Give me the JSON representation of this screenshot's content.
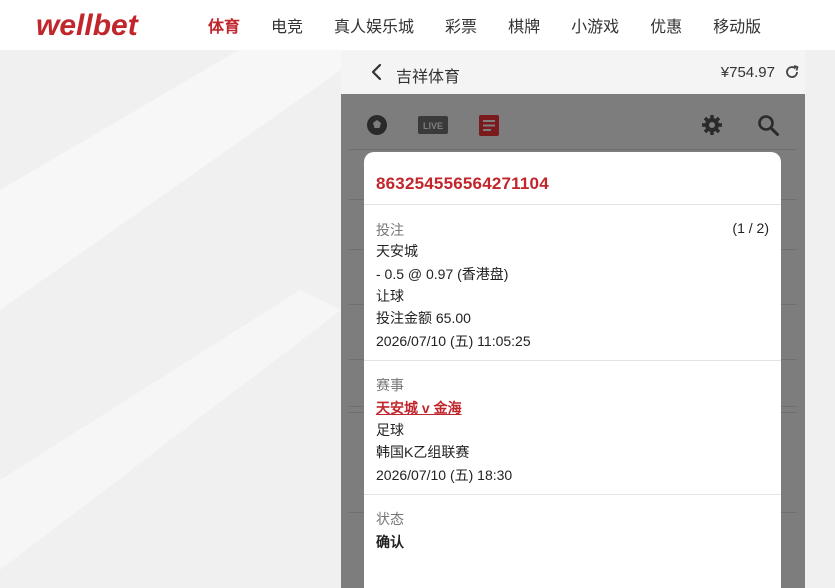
{
  "header": {
    "logo_text": "wellbet",
    "nav": [
      "体育",
      "电竞",
      "真人娱乐城",
      "彩票",
      "棋牌",
      "小游戏",
      "优惠",
      "移动版"
    ]
  },
  "panel": {
    "title": "吉祥体育",
    "balance": "¥754.97",
    "toolbar_icons": [
      "soccer-ball-icon",
      "live-icon",
      "bet-slip-icon",
      "gear-icon",
      "search-icon"
    ],
    "live_label": "LIVE"
  },
  "bet": {
    "ticket_id": "863254556564271104",
    "section_bet": "投注",
    "pager": "(1 / 2)",
    "team": "天安城",
    "odds": "- 0.5 @ 0.97 (香港盘)",
    "market": "让球",
    "stake": "投注金额 65.00",
    "bet_time": "2026/07/10 (五) 11:05:25",
    "section_event": "赛事",
    "match": "天安城 v 金海",
    "sport": "足球",
    "league": "韩国K乙组联赛",
    "match_time": "2026/07/10 (五) 18:30",
    "section_status": "状态",
    "status": "确认"
  },
  "colors": {
    "brand": "#c0262c",
    "overlay": "#7d7d7d"
  }
}
